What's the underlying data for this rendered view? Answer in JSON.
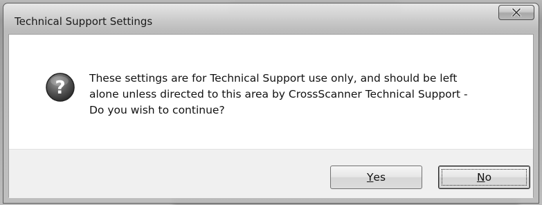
{
  "dialog": {
    "title": "Technical Support Settings",
    "close_icon": "close-icon",
    "message_icon": "question-icon",
    "message": "These settings are for Technical Support use only, and should be left\nalone unless directed to this area by CrossScanner Technical Support -\nDo you wish to continue?",
    "buttons": {
      "yes": {
        "mnemonic": "Y",
        "rest": "es"
      },
      "no": {
        "mnemonic": "N",
        "rest": "o"
      }
    }
  }
}
